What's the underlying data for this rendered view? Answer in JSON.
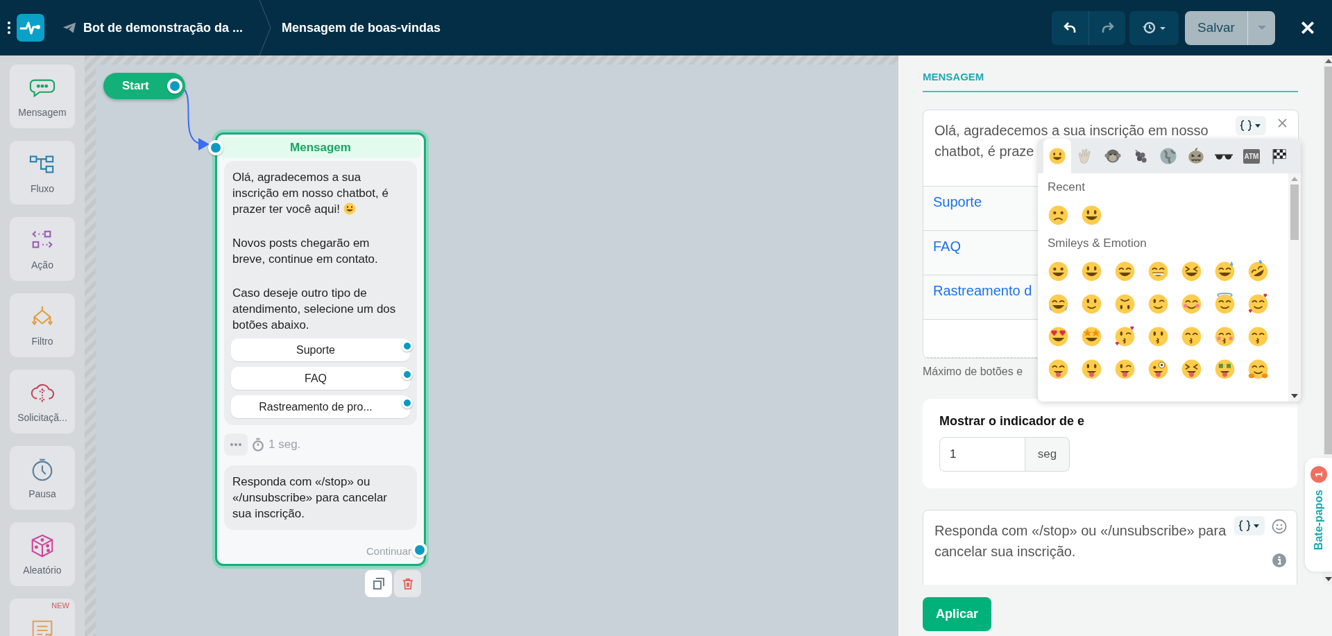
{
  "topbar": {
    "bot_name": "Bot de demonstração da ...",
    "step_name": "Mensagem de boas-vindas",
    "undo": {
      "disabled": false
    },
    "redo": {
      "disabled": true
    },
    "save": {
      "label": "Salvar",
      "disabled": true
    }
  },
  "sidebar": {
    "items": [
      {
        "kind": "message",
        "label": "Mensagem"
      },
      {
        "kind": "flow",
        "label": "Fluxo"
      },
      {
        "kind": "action",
        "label": "Ação"
      },
      {
        "kind": "filter",
        "label": "Filtro"
      },
      {
        "kind": "request",
        "label": "Solicitaçã..."
      },
      {
        "kind": "pause",
        "label": "Pausa"
      },
      {
        "kind": "random",
        "label": "Aleatório"
      },
      {
        "kind": "note",
        "badge": "NEW"
      }
    ]
  },
  "canvas": {
    "start": {
      "label": "Start"
    },
    "node": {
      "title": "Mensagem",
      "selected": true,
      "paragraphs": [
        {
          "text": "Olá, agradecemos a sua inscrição em nosso chatbot, é prazer ter você aqui!",
          "emoji": true
        },
        {
          "text": "Novos posts chegarão em breve, continue em contato."
        },
        {
          "text": "Caso deseje outro tipo de atendimento, selecione um dos botões abaixo."
        }
      ],
      "buttons": [
        "Suporte",
        "FAQ",
        "Rastreamento de pro..."
      ],
      "delay": "1 seg.",
      "second_message": "Responda com «/stop» ou «/unsubscribe» para cancelar sua inscrição.",
      "continue": "Continuar"
    }
  },
  "panel": {
    "heading": "MENSAGEM",
    "message_text": "Olá, agradecemos a sua inscrição em nosso chatbot, é praze",
    "buttons": [
      "Suporte",
      "FAQ",
      "Rastreamento d"
    ],
    "max_buttons_note": "Máximo de botões e",
    "typing": {
      "title": "Mostrar o indicador de e",
      "value": "1",
      "unit": "seg"
    },
    "second_text": "Responda com «/stop» ou «/unsubscribe» para cancelar sua inscrição.",
    "apply": "Aplicar",
    "chats_tab": {
      "label": "Bate-papos",
      "badge": "1"
    },
    "emoji_picker": {
      "tabs": [
        {
          "kind": "smileys",
          "selected": true
        },
        {
          "kind": "people",
          "selected": false
        },
        {
          "kind": "animals",
          "selected": false
        },
        {
          "kind": "food",
          "selected": false
        },
        {
          "kind": "travel",
          "selected": false
        },
        {
          "kind": "activities",
          "selected": false
        },
        {
          "kind": "objects",
          "selected": false
        },
        {
          "kind": "symbols",
          "selected": false,
          "label": "ATM"
        },
        {
          "kind": "flags",
          "selected": false
        }
      ],
      "sections": [
        {
          "title": "Recent"
        },
        {
          "title": "Smileys & Emotion"
        }
      ]
    }
  }
}
